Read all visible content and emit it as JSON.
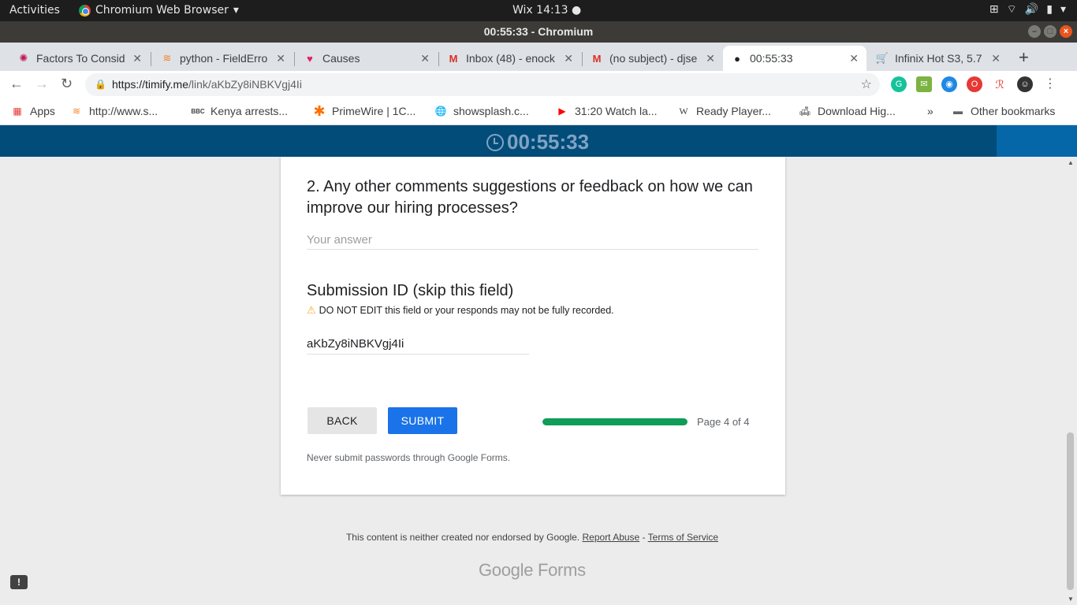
{
  "os_bar": {
    "activities": "Activities",
    "app_name": "Chromium Web Browser",
    "clock": "Wix 14:13 ●"
  },
  "window": {
    "title": "00:55:33 - Chromium"
  },
  "tabs": [
    {
      "title": "Factors To Consid",
      "icon": "circle-dots-icon"
    },
    {
      "title": "python - FieldErro",
      "icon": "stack-overflow-icon"
    },
    {
      "title": "Causes",
      "icon": "causes-icon"
    },
    {
      "title": "Inbox (48) - enock",
      "icon": "gmail-icon"
    },
    {
      "title": "(no subject) - djse",
      "icon": "gmail-icon"
    },
    {
      "title": "00:55:33",
      "icon": "timify-icon",
      "active": true
    },
    {
      "title": "Infinix Hot S3, 5.7",
      "icon": "cart-icon"
    }
  ],
  "address": {
    "host": "https://timify.me",
    "path": "/link/aKbZy8iNBKVgj4Ii"
  },
  "bookmarks": [
    {
      "label": "Apps",
      "icon": "apps-grid-icon"
    },
    {
      "label": "http://www.s...",
      "icon": "stack-overflow-icon"
    },
    {
      "label": "Kenya arrests...",
      "icon": "bbc-icon"
    },
    {
      "label": "PrimeWire | 1C...",
      "icon": "asterisk-icon"
    },
    {
      "label": "showsplash.c...",
      "icon": "globe-icon"
    },
    {
      "label": "31:20 Watch la...",
      "icon": "youtube-icon"
    },
    {
      "label": "Ready Player...",
      "icon": "wikipedia-icon"
    },
    {
      "label": "Download Hig...",
      "icon": "couch-icon"
    },
    {
      "label": "»",
      "icon": ""
    },
    {
      "label": "Other bookmarks",
      "icon": "folder-icon"
    }
  ],
  "timer": {
    "value": "00:55:33"
  },
  "form": {
    "question2": "2. Any other comments suggestions or feedback on how we can improve our hiring processes?",
    "answer_placeholder": "Your answer",
    "submission_title": "Submission ID (skip this field)",
    "submission_desc": "DO NOT EDIT this field or your responds may not be fully recorded.",
    "submission_value": "aKbZy8iNBKVgj4Ii",
    "back_label": "BACK",
    "submit_label": "SUBMIT",
    "progress_fraction": 1.0,
    "page_label": "Page 4 of 4",
    "never_submit": "Never submit passwords through Google Forms."
  },
  "footer": {
    "disclaimer": "This content is neither created nor endorsed by Google.",
    "report_abuse": "Report Abuse",
    "sep": " - ",
    "terms": "Terms of Service",
    "brand_google": "Google",
    "brand_forms": "Forms"
  },
  "colors": {
    "timer_bar": "#024c7a",
    "submit": "#1a73e8",
    "progress": "#0f9d58"
  }
}
